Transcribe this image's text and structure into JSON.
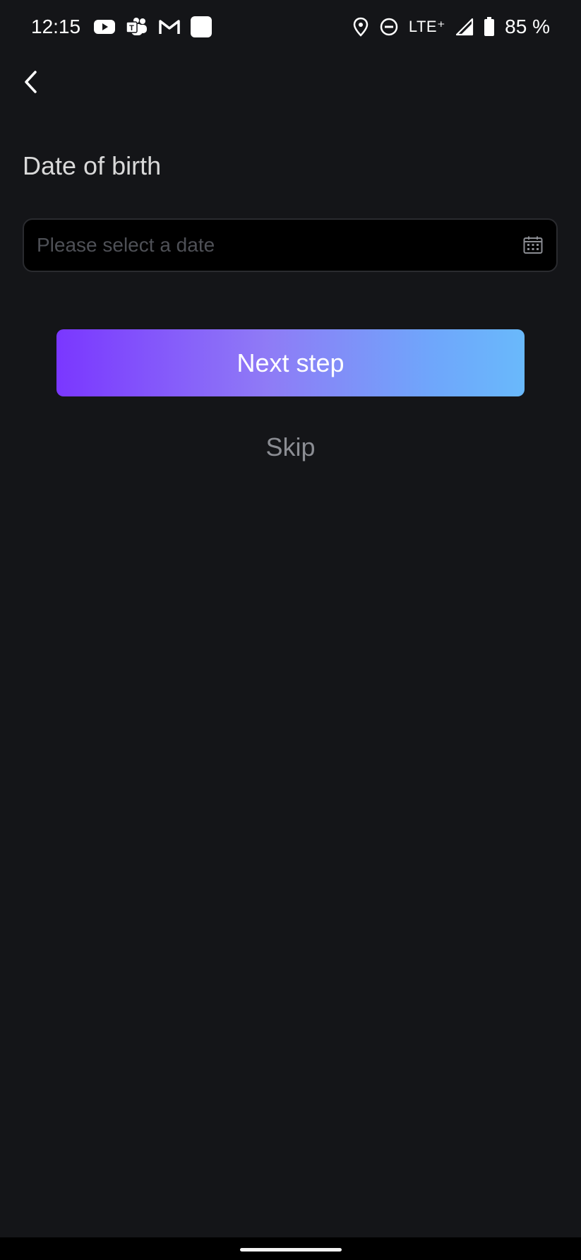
{
  "status_bar": {
    "time": "12:15",
    "network": "LTE⁺",
    "battery": "85 %",
    "icons_left": [
      "youtube-icon",
      "teams-icon",
      "gmail-icon",
      "app-square-icon"
    ],
    "icons_right": [
      "location-icon",
      "do-not-disturb-icon",
      "signal-icon",
      "battery-icon"
    ]
  },
  "header": {
    "back_icon": "chevron-left-icon"
  },
  "form": {
    "label": "Date of birth",
    "date_field": {
      "value": "",
      "placeholder": "Please select a date",
      "icon": "calendar-icon"
    },
    "next_button": "Next step",
    "skip_link": "Skip"
  },
  "colors": {
    "background": "#141518",
    "input_background": "#000000",
    "gradient_start": "#7a37ff",
    "gradient_end": "#69b9fb",
    "skip_text": "#8b8d93"
  }
}
